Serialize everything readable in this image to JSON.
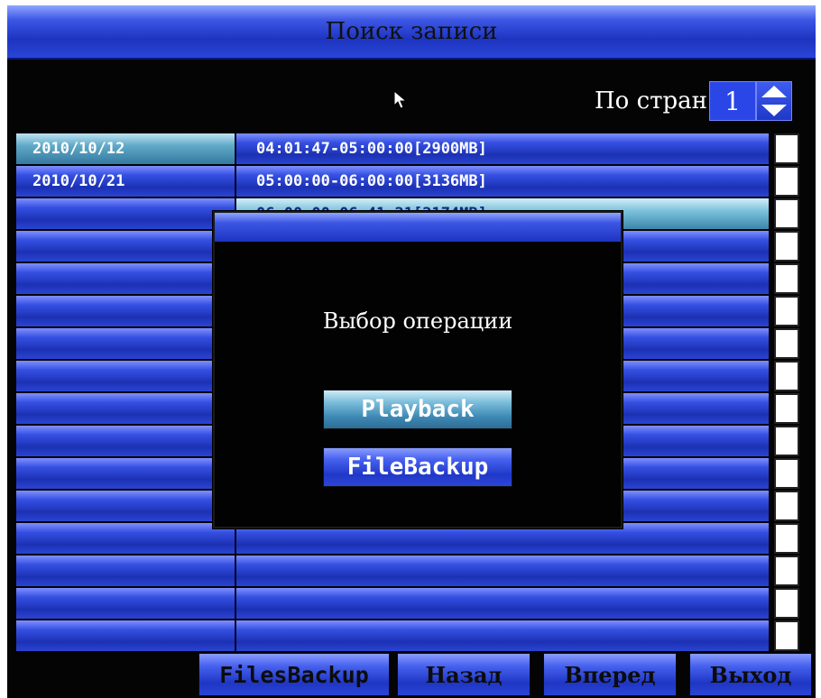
{
  "window": {
    "title": "Поиск записи"
  },
  "pager": {
    "label": "По стран",
    "page": "1",
    "spin_icon": "up-down-spinner-icon"
  },
  "records": [
    {
      "date": "2010/10/12",
      "range": "04:01:47-05:00:00[2900MB]",
      "checked": false
    },
    {
      "date": "2010/10/21",
      "range": "05:00:00-06:00:00[3136MB]",
      "checked": false
    },
    {
      "date": "",
      "range": "06:00:00-06:41:21[2174MB]",
      "checked": false
    },
    {
      "date": "",
      "range": "",
      "checked": false
    },
    {
      "date": "",
      "range": "",
      "checked": false
    },
    {
      "date": "",
      "range": "",
      "checked": false
    },
    {
      "date": "",
      "range": "",
      "checked": false
    },
    {
      "date": "",
      "range": "",
      "checked": false
    },
    {
      "date": "",
      "range": "",
      "checked": false
    },
    {
      "date": "",
      "range": "",
      "checked": false
    },
    {
      "date": "",
      "range": "",
      "checked": false
    },
    {
      "date": "",
      "range": "",
      "checked": false
    },
    {
      "date": "",
      "range": "",
      "checked": false
    },
    {
      "date": "",
      "range": "",
      "checked": false
    },
    {
      "date": "",
      "range": "",
      "checked": false
    },
    {
      "date": "",
      "range": "",
      "checked": false
    }
  ],
  "dialog": {
    "heading": "Выбор операции",
    "playback_label": "Playback",
    "filebackup_label": "FileBackup"
  },
  "toolbar": {
    "files_backup_label": "FilesBackup",
    "back_label": "Назад",
    "forward_label": "Вперед",
    "exit_label": "Выход"
  },
  "colors": {
    "accent_blue": "#2a46e6",
    "highlight_cyan": "#5fa9c8",
    "background": "#040404"
  }
}
